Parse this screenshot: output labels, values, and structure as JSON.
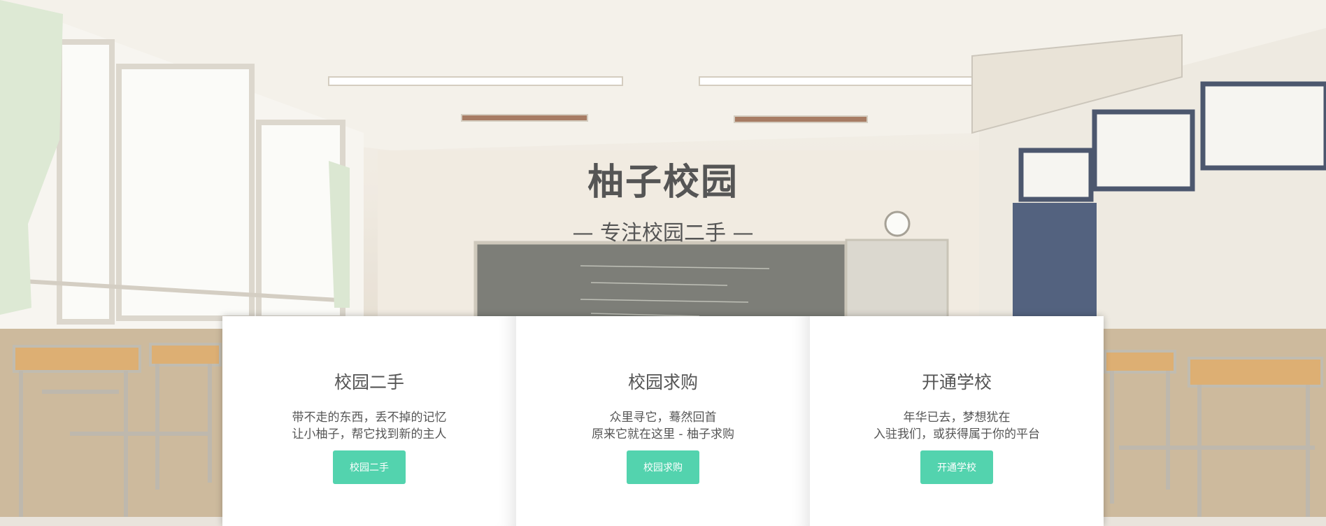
{
  "hero": {
    "title": "柚子校园",
    "subtitle": "— 专注校园二手 —"
  },
  "cards": [
    {
      "title": "校园二手",
      "line1": "带不走的东西，丢不掉的记忆",
      "line2": "让小柚子，帮它找到新的主人",
      "button": "校园二手"
    },
    {
      "title": "校园求购",
      "line1": "众里寻它，蓦然回首",
      "line2": "原来它就在这里 - 柚子求购",
      "button": "校园求购"
    },
    {
      "title": "开通学校",
      "line1": "年华已去，梦想犹在",
      "line2": "入驻我们，或获得属于你的平台",
      "button": "开通学校"
    }
  ],
  "colors": {
    "accent": "#53d3ae",
    "text": "#555555"
  }
}
